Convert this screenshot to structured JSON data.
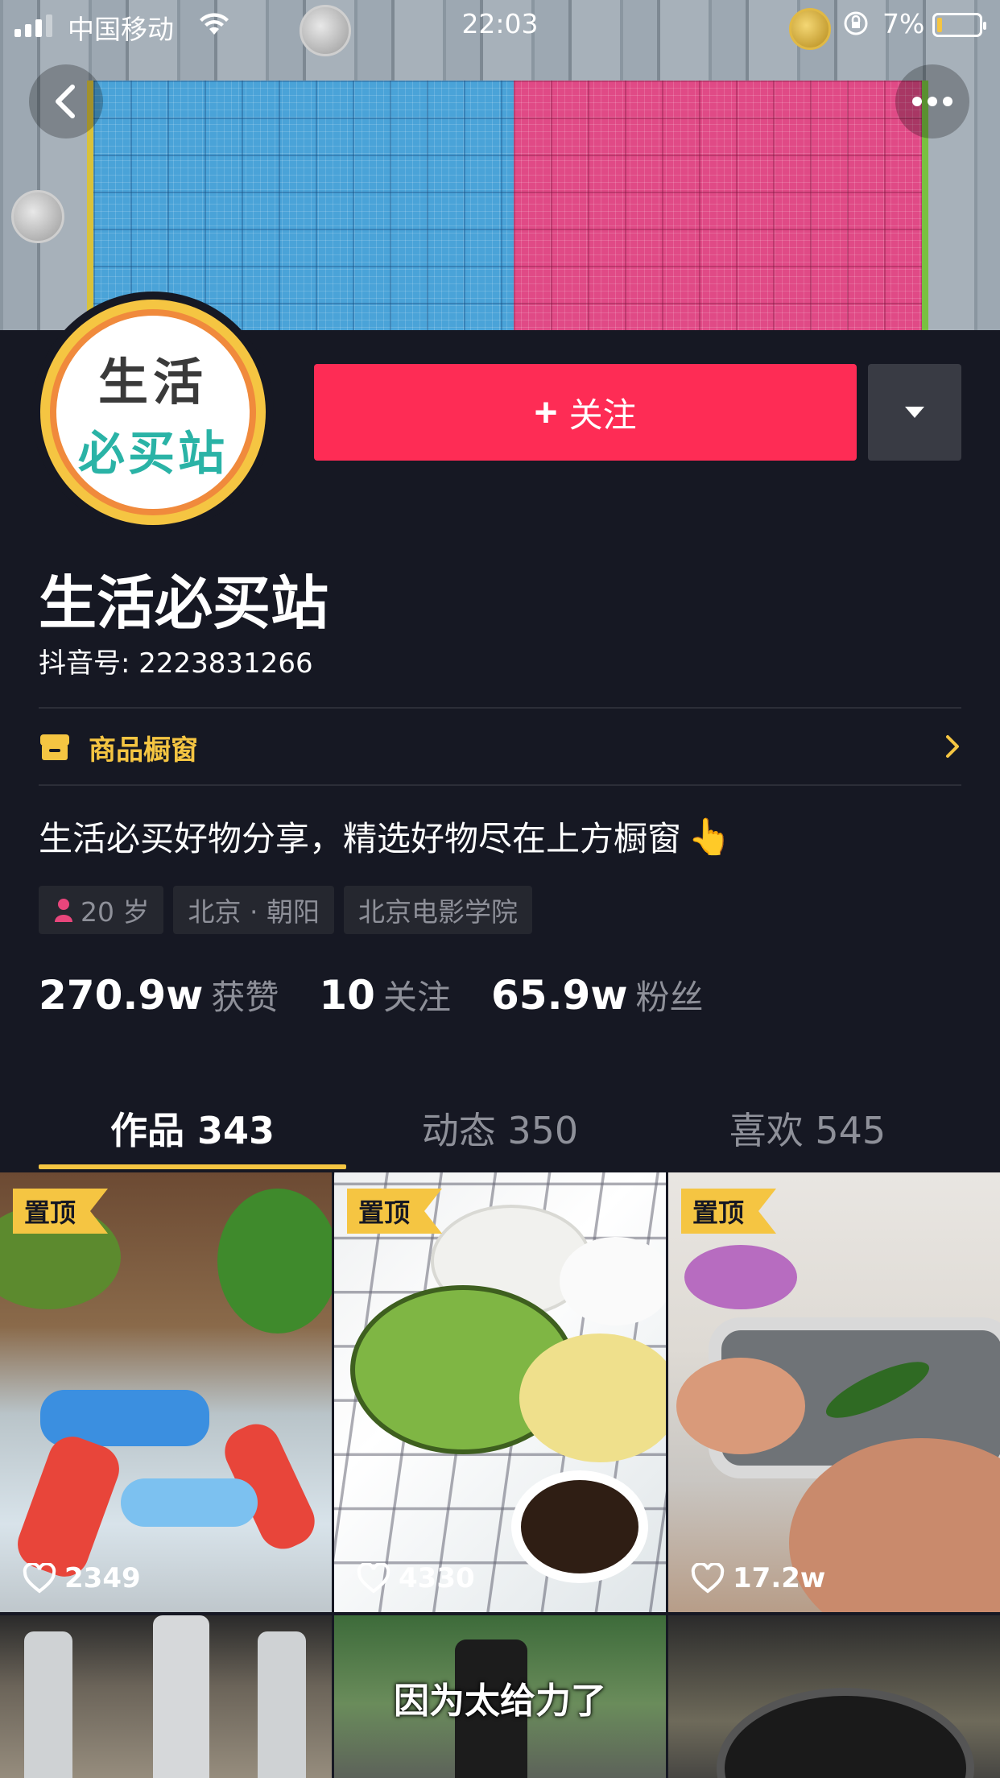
{
  "status_bar": {
    "carrier": "中国移动",
    "time": "22:03",
    "battery": "7%"
  },
  "profile": {
    "avatar_line1": "生活",
    "avatar_line2": "必买站",
    "follow_label": "关注",
    "name": "生活必买站",
    "douyin_id": "抖音号: 2223831266",
    "shop_window": "商品橱窗",
    "bio": "生活必买好物分享，精选好物尽在上方橱窗",
    "bio_emoji": "👆",
    "tags": [
      "20 岁",
      "北京 · 朝阳",
      "北京电影学院"
    ],
    "stats": [
      {
        "num": "270.9w",
        "label": "获赞"
      },
      {
        "num": "10",
        "label": "关注"
      },
      {
        "num": "65.9w",
        "label": "粉丝"
      }
    ]
  },
  "tabs": [
    {
      "label": "作品 343",
      "active": true
    },
    {
      "label": "动态 350",
      "active": false
    },
    {
      "label": "喜欢 545",
      "active": false
    }
  ],
  "videos": [
    {
      "pinned": "置顶",
      "likes": "2349"
    },
    {
      "pinned": "置顶",
      "likes": "4330"
    },
    {
      "pinned": "置顶",
      "likes": "17.2w"
    },
    {
      "caption": ""
    },
    {
      "caption": "因为太给力了"
    },
    {
      "caption": ""
    }
  ],
  "colors": {
    "background": "#161823",
    "accent_red": "#fe2c55",
    "accent_yellow": "#f5c542",
    "muted_text": "#8e9099"
  }
}
